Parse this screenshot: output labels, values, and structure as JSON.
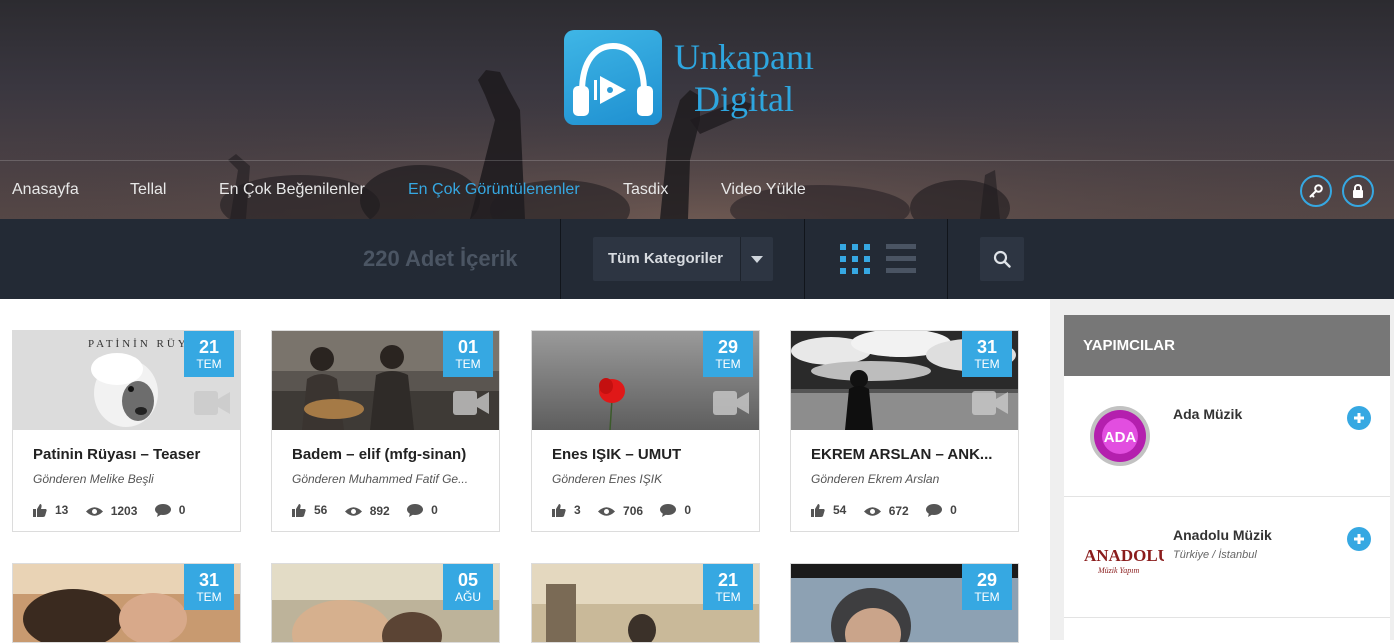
{
  "brand": {
    "line1": "Unkapanı",
    "line2": "Digital",
    "accent": "#36a8e2"
  },
  "nav": {
    "items": [
      {
        "label": "Anasayfa",
        "active": false
      },
      {
        "label": "Tellal",
        "active": false
      },
      {
        "label": "En Çok Beğenilenler",
        "active": false
      },
      {
        "label": "En Çok Görüntülenenler",
        "active": true
      },
      {
        "label": "Tasdix",
        "active": false
      },
      {
        "label": "Video Yükle",
        "active": false
      }
    ],
    "icons": [
      "key-icon",
      "lock-icon"
    ]
  },
  "filterbar": {
    "count_text": "220 Adet İçerik",
    "category_select": "Tüm Kategoriler",
    "views": [
      "grid-view-icon",
      "list-view-icon"
    ],
    "search_icon": "search-icon"
  },
  "cards": [
    {
      "day": "21",
      "month": "TEM",
      "title": "Patinin Rüyası – Teaser",
      "sender": "Gönderen Melike Beşli",
      "likes": "13",
      "views": "1203",
      "comments": "0",
      "thumb_text": "PATİNİN RÜYASI"
    },
    {
      "day": "01",
      "month": "TEM",
      "title": "Badem – elif (mfg-sinan)",
      "sender": "Gönderen Muhammed Fatif Ge...",
      "likes": "56",
      "views": "892",
      "comments": "0"
    },
    {
      "day": "29",
      "month": "TEM",
      "title": "Enes IŞIK – UMUT",
      "sender": "Gönderen Enes IŞIK",
      "likes": "3",
      "views": "706",
      "comments": "0"
    },
    {
      "day": "31",
      "month": "TEM",
      "title": "EKREM ARSLAN – ANK...",
      "sender": "Gönderen Ekrem Arslan",
      "likes": "54",
      "views": "672",
      "comments": "0"
    }
  ],
  "cards_row2": [
    {
      "day": "31",
      "month": "TEM"
    },
    {
      "day": "05",
      "month": "AĞU"
    },
    {
      "day": "21",
      "month": "TEM"
    },
    {
      "day": "29",
      "month": "TEM"
    }
  ],
  "sidebar": {
    "title": "YAPIMCILAR",
    "producers": [
      {
        "name": "Ada Müzik",
        "location": "",
        "logo_text": "ADA"
      },
      {
        "name": "Anadolu Müzik",
        "location": "Türkiye / İstanbul",
        "logo_text": "ANADOLU",
        "logo_sub": "Müzik Yapım"
      }
    ]
  }
}
